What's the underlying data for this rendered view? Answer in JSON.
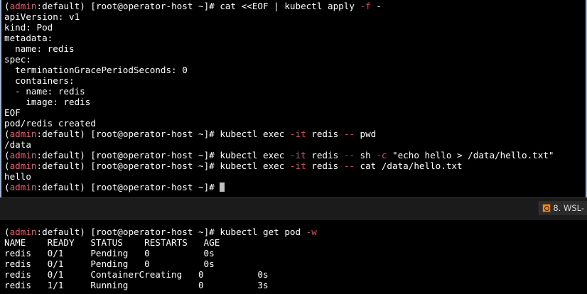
{
  "prompt": {
    "env_open": "(",
    "env_admin": "admin",
    "env_colon": ":",
    "env_ns": "default",
    "env_close": ")",
    "user": " [root@operator-host ~]# "
  },
  "top_pane": {
    "cmd1": "cat <<EOF | kubectl apply ",
    "cmd1_opt": "-f",
    "cmd1_tail": " -",
    "yaml": [
      "apiVersion: v1",
      "kind: Pod",
      "metadata:",
      "  name: redis",
      "spec:",
      "  terminationGracePeriodSeconds: 0",
      "  containers:",
      "  - name: redis",
      "    image: redis",
      "EOF",
      "pod/redis created"
    ],
    "cmd2_a": "kubectl exec ",
    "cmd2_opt": "-it",
    "cmd2_b": " redis ",
    "cmd2_dd": "--",
    "cmd2_c": " pwd",
    "out2": "/data",
    "cmd3_a": "kubectl exec ",
    "cmd3_opt": "-it",
    "cmd3_b": " redis ",
    "cmd3_dd": "--",
    "cmd3_c": " sh ",
    "cmd3_opt2": "-c",
    "cmd3_d": " \"echo hello > /data/hello.txt\"",
    "cmd4_a": "kubectl exec ",
    "cmd4_opt": "-it",
    "cmd4_b": " redis ",
    "cmd4_dd": "--",
    "cmd4_c": " cat /data/hello.txt",
    "out4": "hello"
  },
  "status_bar": {
    "tab_label": "8. WSL-",
    "tab_icon": "terminal-icon"
  },
  "bottom_pane": {
    "cmd": "kubectl get pod ",
    "cmd_opt": "-w",
    "header": "NAME    READY   STATUS    RESTARTS   AGE",
    "rows": [
      "redis   0/1     Pending   0          0s",
      "redis   0/1     Pending   0          0s",
      "redis   0/1     ContainerCreating   0          0s",
      "redis   1/1     Running             0          3s"
    ]
  },
  "colors": {
    "admin": "#e06070",
    "option": "#d64b5c",
    "text": "#ffffff",
    "background": "#000000"
  }
}
